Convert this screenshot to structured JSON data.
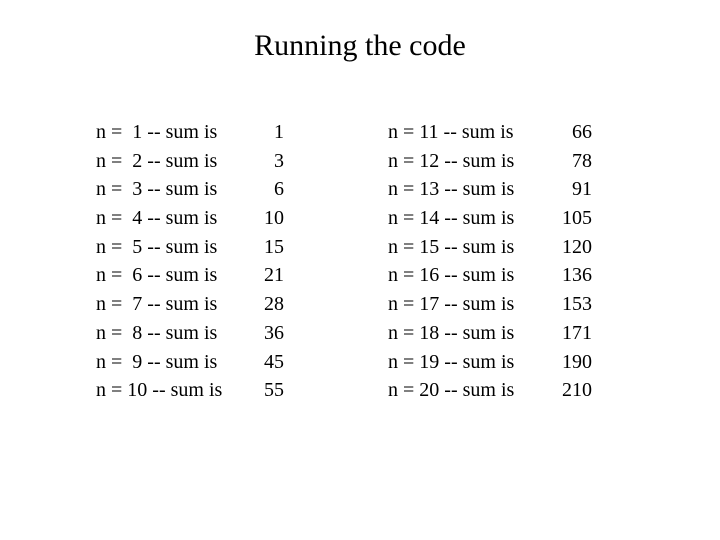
{
  "slide": {
    "title": "Running the code",
    "left_column": [
      {
        "label": "n =  1 -- sum is",
        "value": "1"
      },
      {
        "label": "n =  2 -- sum is",
        "value": "3"
      },
      {
        "label": "n =  3 -- sum is",
        "value": "6"
      },
      {
        "label": "n =  4 -- sum is",
        "value": "10"
      },
      {
        "label": "n =  5 -- sum is",
        "value": "15"
      },
      {
        "label": "n =  6 -- sum is",
        "value": "21"
      },
      {
        "label": "n =  7 -- sum is",
        "value": "28"
      },
      {
        "label": "n =  8 -- sum is",
        "value": "36"
      },
      {
        "label": "n =  9 -- sum is",
        "value": "45"
      },
      {
        "label": "n = 10 -- sum is",
        "value": "55"
      }
    ],
    "right_column": [
      {
        "label": "n = 11 -- sum is",
        "value": "66"
      },
      {
        "label": "n = 12 -- sum is",
        "value": "78"
      },
      {
        "label": "n = 13 -- sum is",
        "value": "91"
      },
      {
        "label": "n = 14 -- sum is",
        "value": "105"
      },
      {
        "label": "n = 15 -- sum is",
        "value": "120"
      },
      {
        "label": "n = 16 -- sum is",
        "value": "136"
      },
      {
        "label": "n = 17 -- sum is",
        "value": "153"
      },
      {
        "label": "n = 18 -- sum is",
        "value": "171"
      },
      {
        "label": "n = 19 -- sum is",
        "value": "190"
      },
      {
        "label": "n = 20 -- sum is",
        "value": "210"
      }
    ]
  }
}
